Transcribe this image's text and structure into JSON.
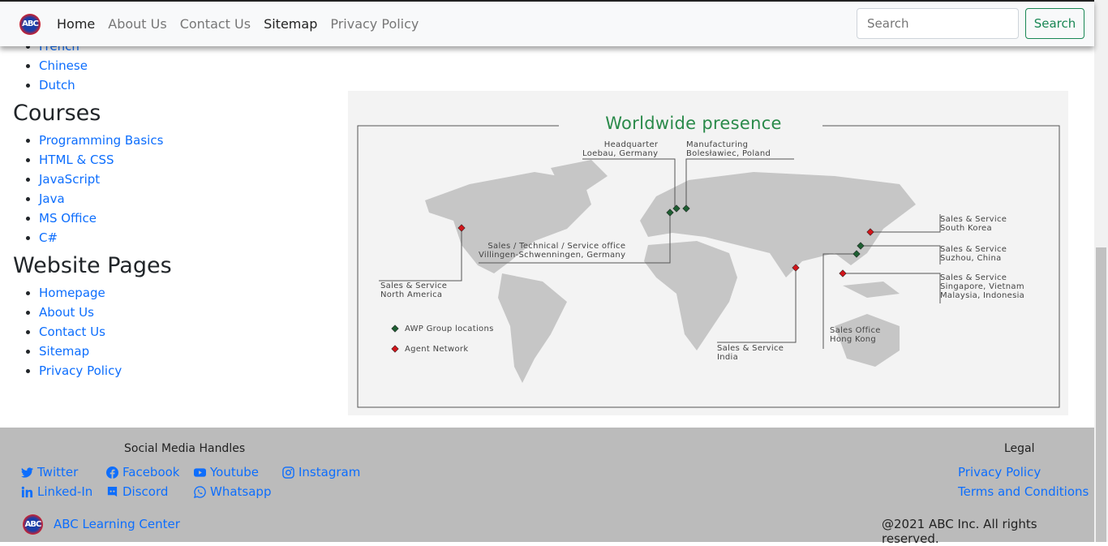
{
  "nav": {
    "logo_text": "ABC",
    "links": [
      "Home",
      "About Us",
      "Contact Us",
      "Sitemap",
      "Privacy Policy"
    ],
    "search_placeholder": "Search",
    "search_button": "Search"
  },
  "languages": [
    "French",
    "Chinese",
    "Dutch"
  ],
  "courses": {
    "heading": "Courses",
    "items": [
      "Programming Basics",
      "HTML & CSS",
      "JavaScript",
      "Java",
      "MS Office",
      "C#"
    ]
  },
  "pages": {
    "heading": "Website Pages",
    "items": [
      "Homepage",
      "About Us",
      "Contact Us",
      "Sitemap",
      "Privacy Policy"
    ]
  },
  "map": {
    "title": "Worldwide presence",
    "labels": {
      "hq": [
        "Headquarter",
        "Loebau, Germany"
      ],
      "mfg": [
        "Manufacturing",
        "Bolesławiec, Poland"
      ],
      "tech": [
        "Sales / Technical / Service office",
        "Villingen-Schwenningen, Germany"
      ],
      "na": [
        "Sales & Service",
        "North America"
      ],
      "kr": [
        "Sales & Service",
        "South Korea"
      ],
      "suzhou": [
        "Sales & Service",
        "Suzhou, China"
      ],
      "sea": [
        "Sales & Service",
        "Singapore, Vietnam",
        "Malaysia, Indonesia"
      ],
      "hk": [
        "Sales Office",
        "Hong Kong"
      ],
      "india": [
        "Sales & Service",
        "India"
      ]
    },
    "legend": [
      "AWP Group locations",
      "Agent Network"
    ],
    "colors": {
      "group": "#1e5e32",
      "agent": "#d0141a"
    }
  },
  "footer": {
    "social_heading": "Social Media Handles",
    "social": [
      "Twitter",
      "Facebook",
      "Youtube",
      "Instagram",
      "Linked-In",
      "Discord",
      "Whatsapp"
    ],
    "legal_heading": "Legal",
    "legal": [
      "Privacy Policy",
      "Terms and Conditions"
    ],
    "brand": "ABC Learning Center",
    "copyright": "@2021 ABC Inc. All rights reserved."
  }
}
